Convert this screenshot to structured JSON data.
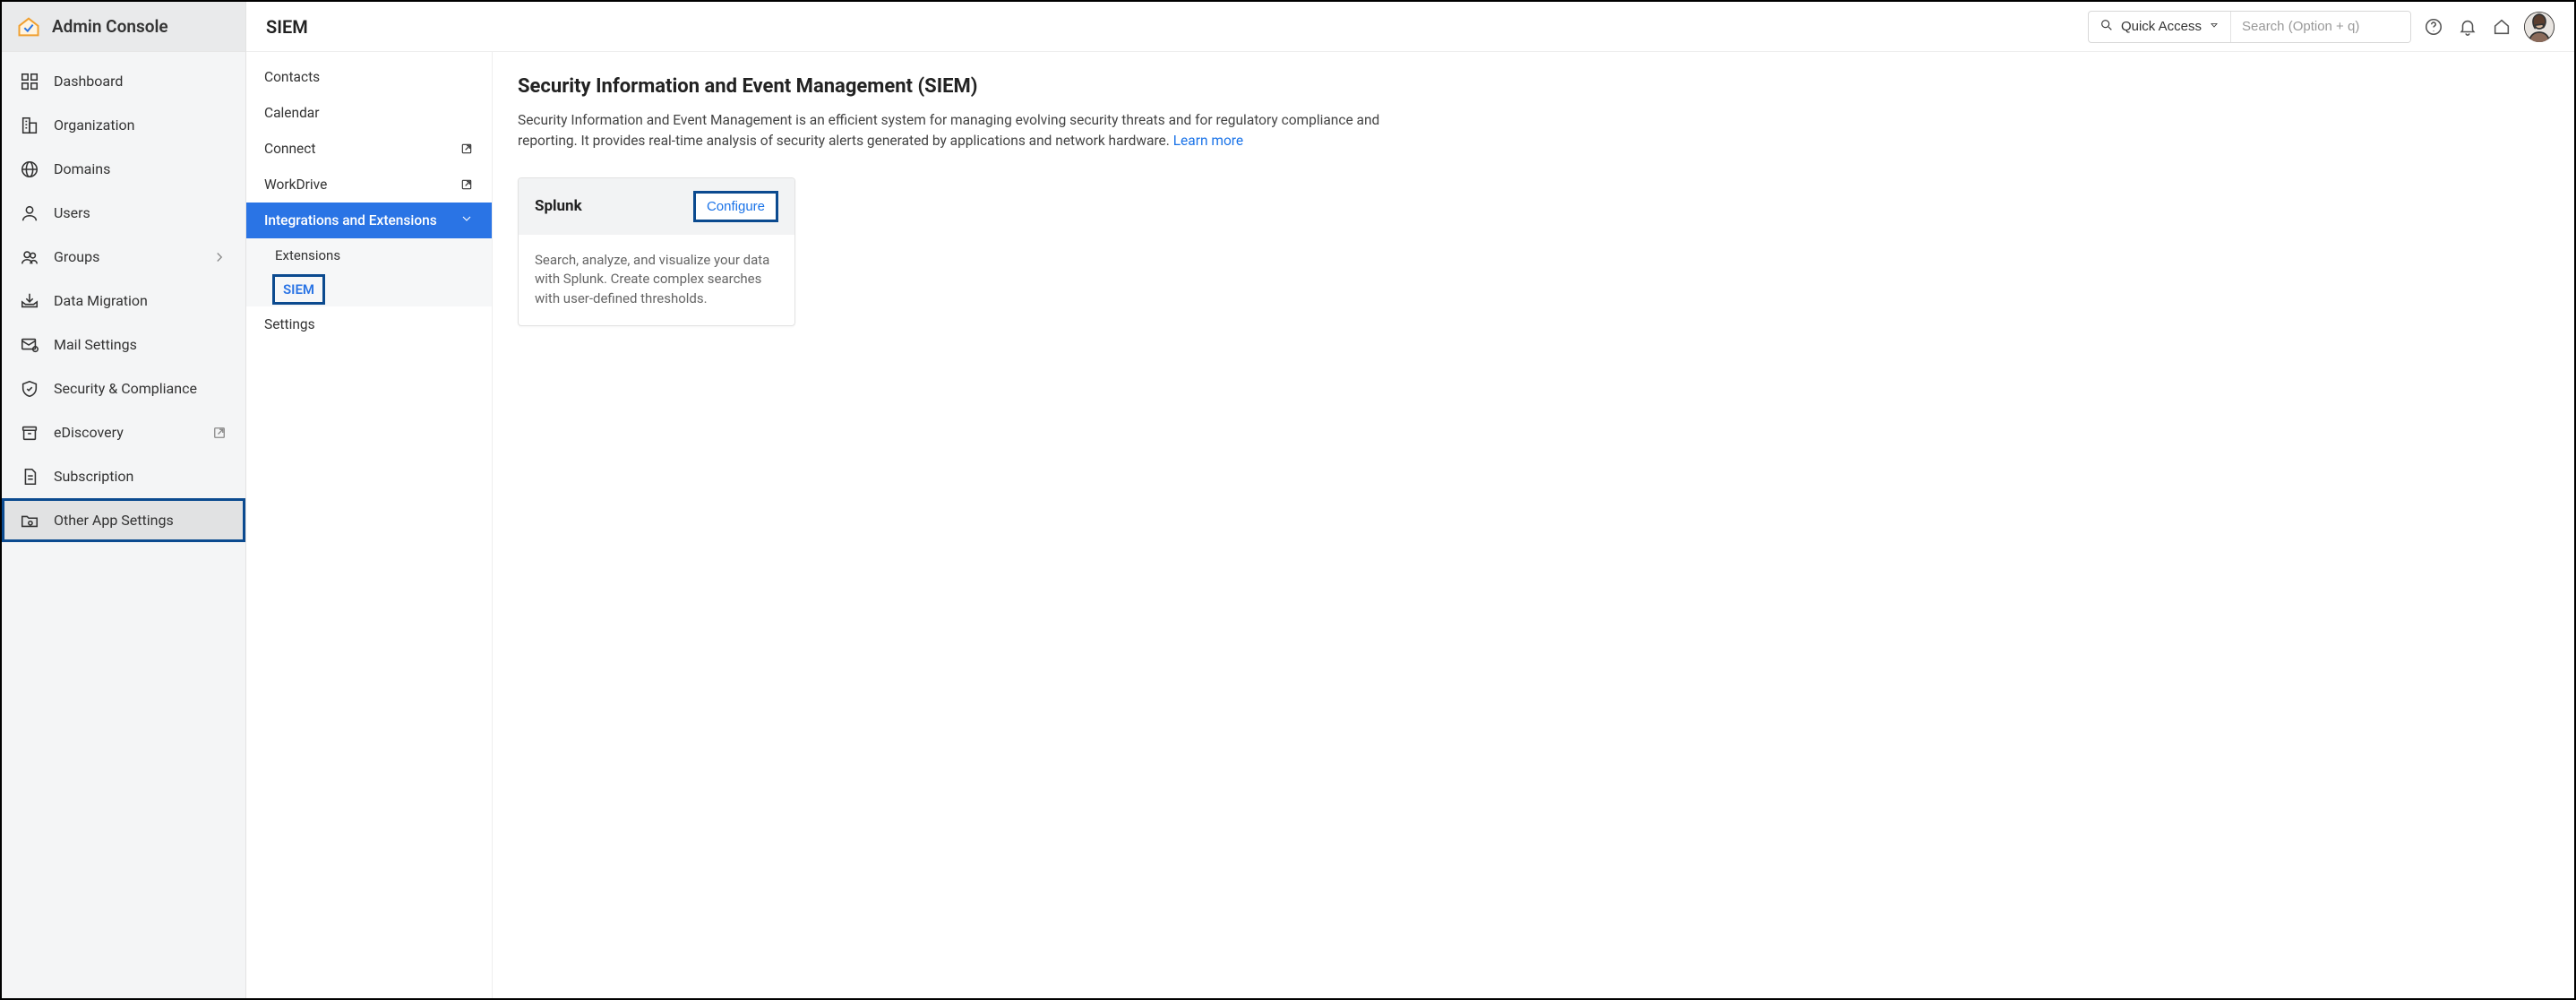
{
  "app": {
    "title": "Admin Console",
    "page_header": "SIEM"
  },
  "topbar": {
    "quick_access_label": "Quick Access",
    "search_placeholder": "Search (Option + q)"
  },
  "sidebar": {
    "items": [
      {
        "label": "Dashboard"
      },
      {
        "label": "Organization"
      },
      {
        "label": "Domains"
      },
      {
        "label": "Users"
      },
      {
        "label": "Groups",
        "has_chevron": true
      },
      {
        "label": "Data Migration"
      },
      {
        "label": "Mail Settings"
      },
      {
        "label": "Security & Compliance"
      },
      {
        "label": "eDiscovery",
        "external": true
      },
      {
        "label": "Subscription"
      },
      {
        "label": "Other App Settings",
        "highlighted": true
      }
    ]
  },
  "subnav": {
    "items": [
      {
        "label": "Contacts"
      },
      {
        "label": "Calendar"
      },
      {
        "label": "Connect",
        "external": true
      },
      {
        "label": "WorkDrive",
        "external": true
      },
      {
        "label": "Integrations and Extensions",
        "active": true
      },
      {
        "label": "Settings"
      }
    ],
    "sub_items": [
      {
        "label": "Extensions"
      },
      {
        "label": "SIEM",
        "selected": true
      }
    ]
  },
  "detail": {
    "heading": "Security Information and Event Management (SIEM)",
    "description": "Security Information and Event Management is an efficient system for managing evolving security threats and for regulatory compliance and reporting. It provides real-time analysis of security alerts generated by applications and network hardware.  ",
    "learn_more": "Learn more",
    "card": {
      "title": "Splunk",
      "button": "Configure",
      "body": "Search, analyze, and visualize your data with Splunk. Create complex searches with user-defined thresholds."
    }
  }
}
